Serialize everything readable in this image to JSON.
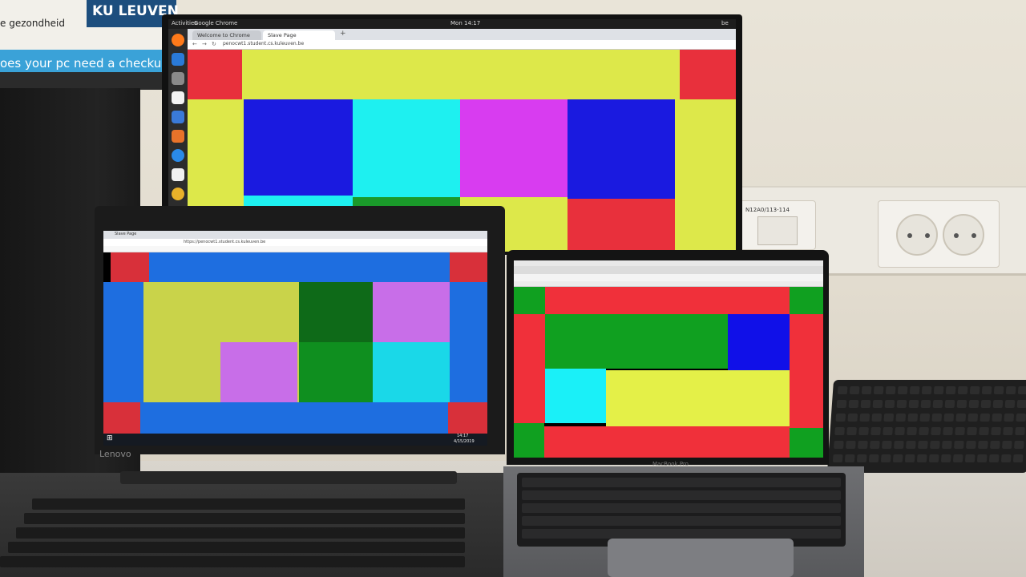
{
  "poster": {
    "brand": "KU LEUVEN",
    "line1": "e gezondheid",
    "line2": "oes your pc need a checkup"
  },
  "wall_socket_label": "N12A0/113-114",
  "monitor": {
    "topbar": {
      "activities": "Activities",
      "app": "Google Chrome",
      "time": "Mon 14:17",
      "lang": "be"
    },
    "tabs": [
      "Welcome to Chrome",
      "Slave Page"
    ],
    "url": "penocwt1.student.cs.kuleuven.be",
    "dock_icons": [
      "firefox-icon",
      "thunderbird-icon",
      "files-icon",
      "libreoffice-icon",
      "document-icon",
      "software-icon",
      "help-icon",
      "amazon-icon",
      "chrome-icon"
    ],
    "colors": {
      "red": "#e8303c",
      "yellow": "#dde84a",
      "blue": "#1a1ae0",
      "cyan": "#1ef0f0",
      "magenta": "#d83cf0",
      "green": "#1a9a2a"
    }
  },
  "laptop1": {
    "brand": "Lenovo",
    "tabs": [
      "Slave Page"
    ],
    "url": "https://penocwt1.student.cs.kuleuven.be",
    "taskbar_time": "14:17",
    "taskbar_date": "4/15/2019",
    "colors": {
      "red": "#d8303a",
      "blue": "#1e6ee0",
      "yellow": "#c9d34a",
      "green_dark": "#0e6a18",
      "green": "#0f8f1f",
      "violet": "#c86ee8",
      "cyan": "#1ad8e8"
    }
  },
  "laptop2": {
    "brand": "MacBook Pro",
    "colors": {
      "red": "#f0303a",
      "green": "#10a020",
      "blue": "#1010e8",
      "cyan": "#1af0f8",
      "yellow": "#e4f048"
    }
  }
}
